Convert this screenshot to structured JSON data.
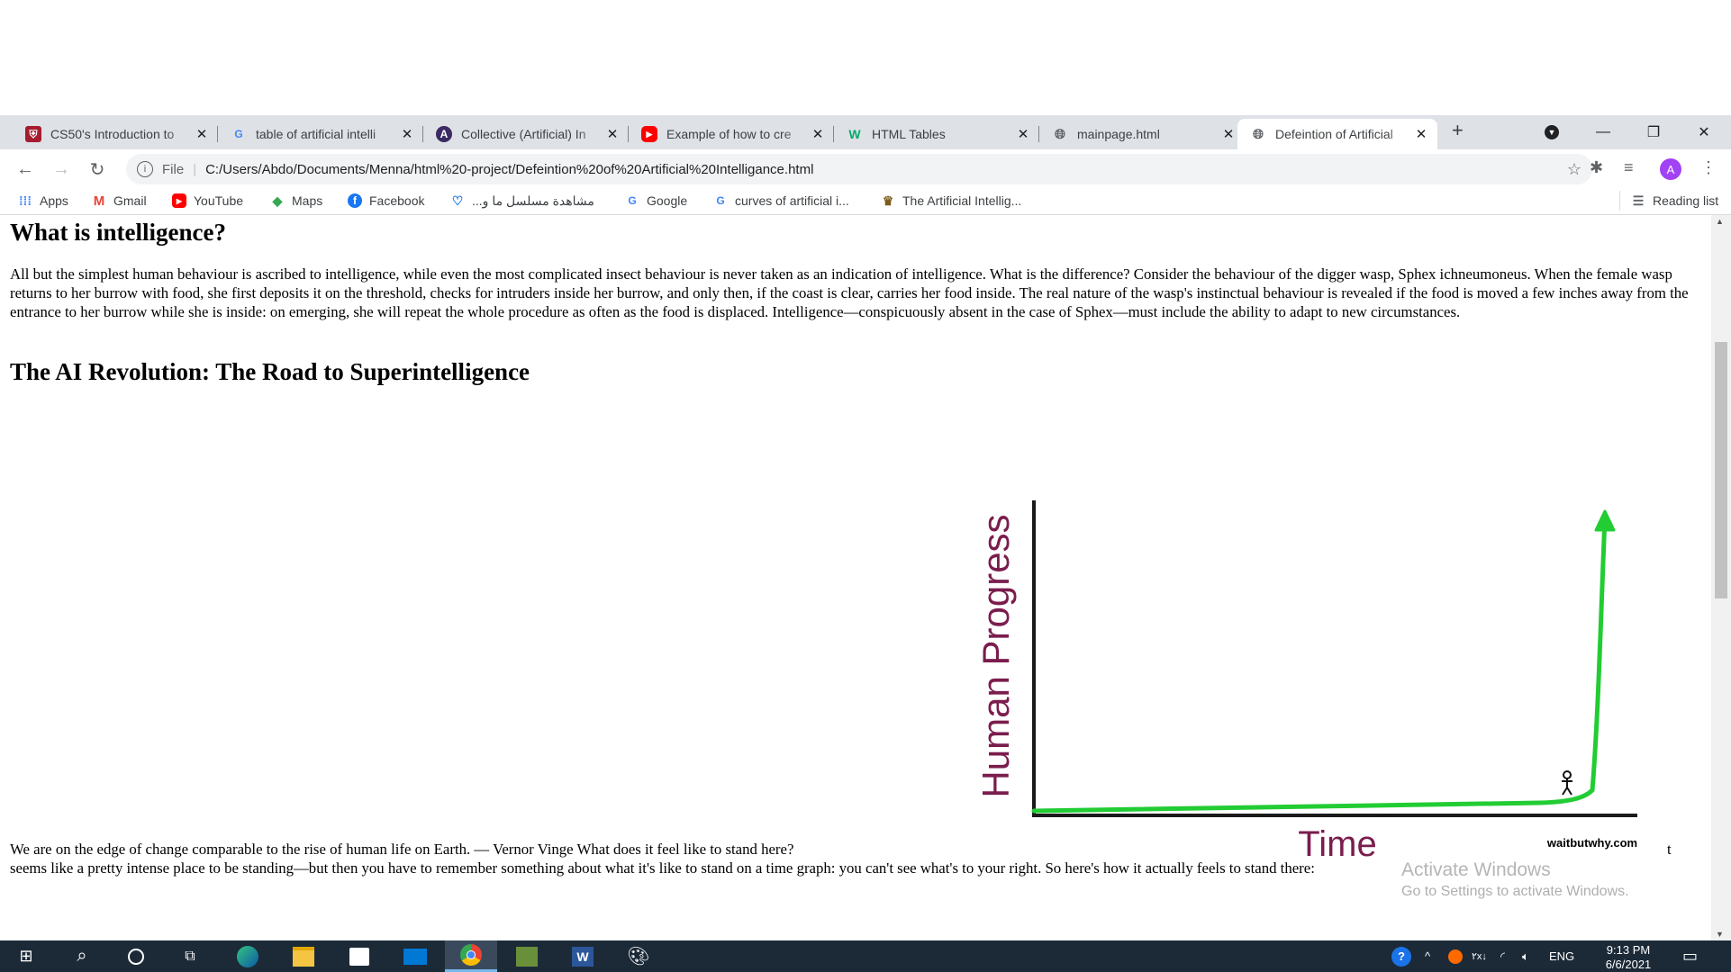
{
  "tabs": [
    {
      "title": "CS50's Introduction to",
      "icon": "harvard-shield-icon",
      "color": "#a51c30"
    },
    {
      "title": "table of artificial intelli",
      "icon": "google-icon",
      "color": "#4285f4"
    },
    {
      "title": "Collective (Artificial) In",
      "icon": "collective-a-icon",
      "color": "#3b2a63"
    },
    {
      "title": "Example of how to cre",
      "icon": "youtube-icon",
      "color": "#ff0000"
    },
    {
      "title": "HTML Tables",
      "icon": "w3schools-icon",
      "color": "#04aa6d"
    },
    {
      "title": "mainpage.html",
      "icon": "globe-icon",
      "color": "#5f6368"
    },
    {
      "title": "Defeintion of Artificial",
      "icon": "globe-icon",
      "color": "#5f6368"
    }
  ],
  "address": {
    "scheme_label": "File",
    "url": "C:/Users/Abdo/Documents/Menna/html%20-project/Defeintion%20of%20Artificial%20Intelligance.html"
  },
  "profile_initial": "A",
  "bookmarks": [
    {
      "label": "Apps",
      "icon": "apps-grid-icon"
    },
    {
      "label": "Gmail",
      "icon": "gmail-icon"
    },
    {
      "label": "YouTube",
      "icon": "youtube-icon"
    },
    {
      "label": "Maps",
      "icon": "maps-icon"
    },
    {
      "label": "Facebook",
      "icon": "facebook-icon"
    },
    {
      "label": "مشاهدة مسلسل ما و...",
      "icon": "bookmark-site-icon"
    },
    {
      "label": "Google",
      "icon": "google-icon"
    },
    {
      "label": "curves of artificial i...",
      "icon": "google-icon"
    },
    {
      "label": "The Artificial Intellig...",
      "icon": "bookmark-site-icon"
    }
  ],
  "reading_list_label": "Reading list",
  "page": {
    "heading1": "What is intelligence?",
    "paragraph1": "All but the simplest human behaviour is ascribed to intelligence, while even the most complicated insect behaviour is never taken as an indication of intelligence. What is the difference? Consider the behaviour of the digger wasp, Sphex ichneumoneus. When the female wasp returns to her burrow with food, she first deposits it on the threshold, checks for intruders inside her burrow, and only then, if the coast is clear, carries her food inside. The real nature of the wasp's instinctual behaviour is revealed if the food is moved a few inches away from the entrance to her burrow while she is inside: on emerging, she will repeat the whole procedure as often as the food is displaced. Intelligence—conspicuously absent in the case of Sphex—must include the ability to adapt to new circumstances.",
    "heading2": "The AI Revolution: The Road to Superintelligence",
    "paragraph2_line1": "We are on the edge of change comparable to the rise of human life on Earth. — Vernor Vinge What does it feel like to stand here?",
    "paragraph2_line2": "seems like a pretty intense place to be standing—but then you have to remember something about what it's like to stand on a time graph: you can't see what's to your right. So here's how it actually feels to stand there:",
    "trailing_char": "t"
  },
  "figure": {
    "ylabel": "Human Progress",
    "xlabel": "Time",
    "credit": "waitbutwhy.com",
    "curve_color": "#22cc33",
    "label_color": "#7a1d4d"
  },
  "watermark": {
    "line1": "Activate Windows",
    "line2": "Go to Settings to activate Windows."
  },
  "taskbar": {
    "time": "9:13 PM",
    "date": "6/6/2021",
    "lang": "ENG"
  }
}
